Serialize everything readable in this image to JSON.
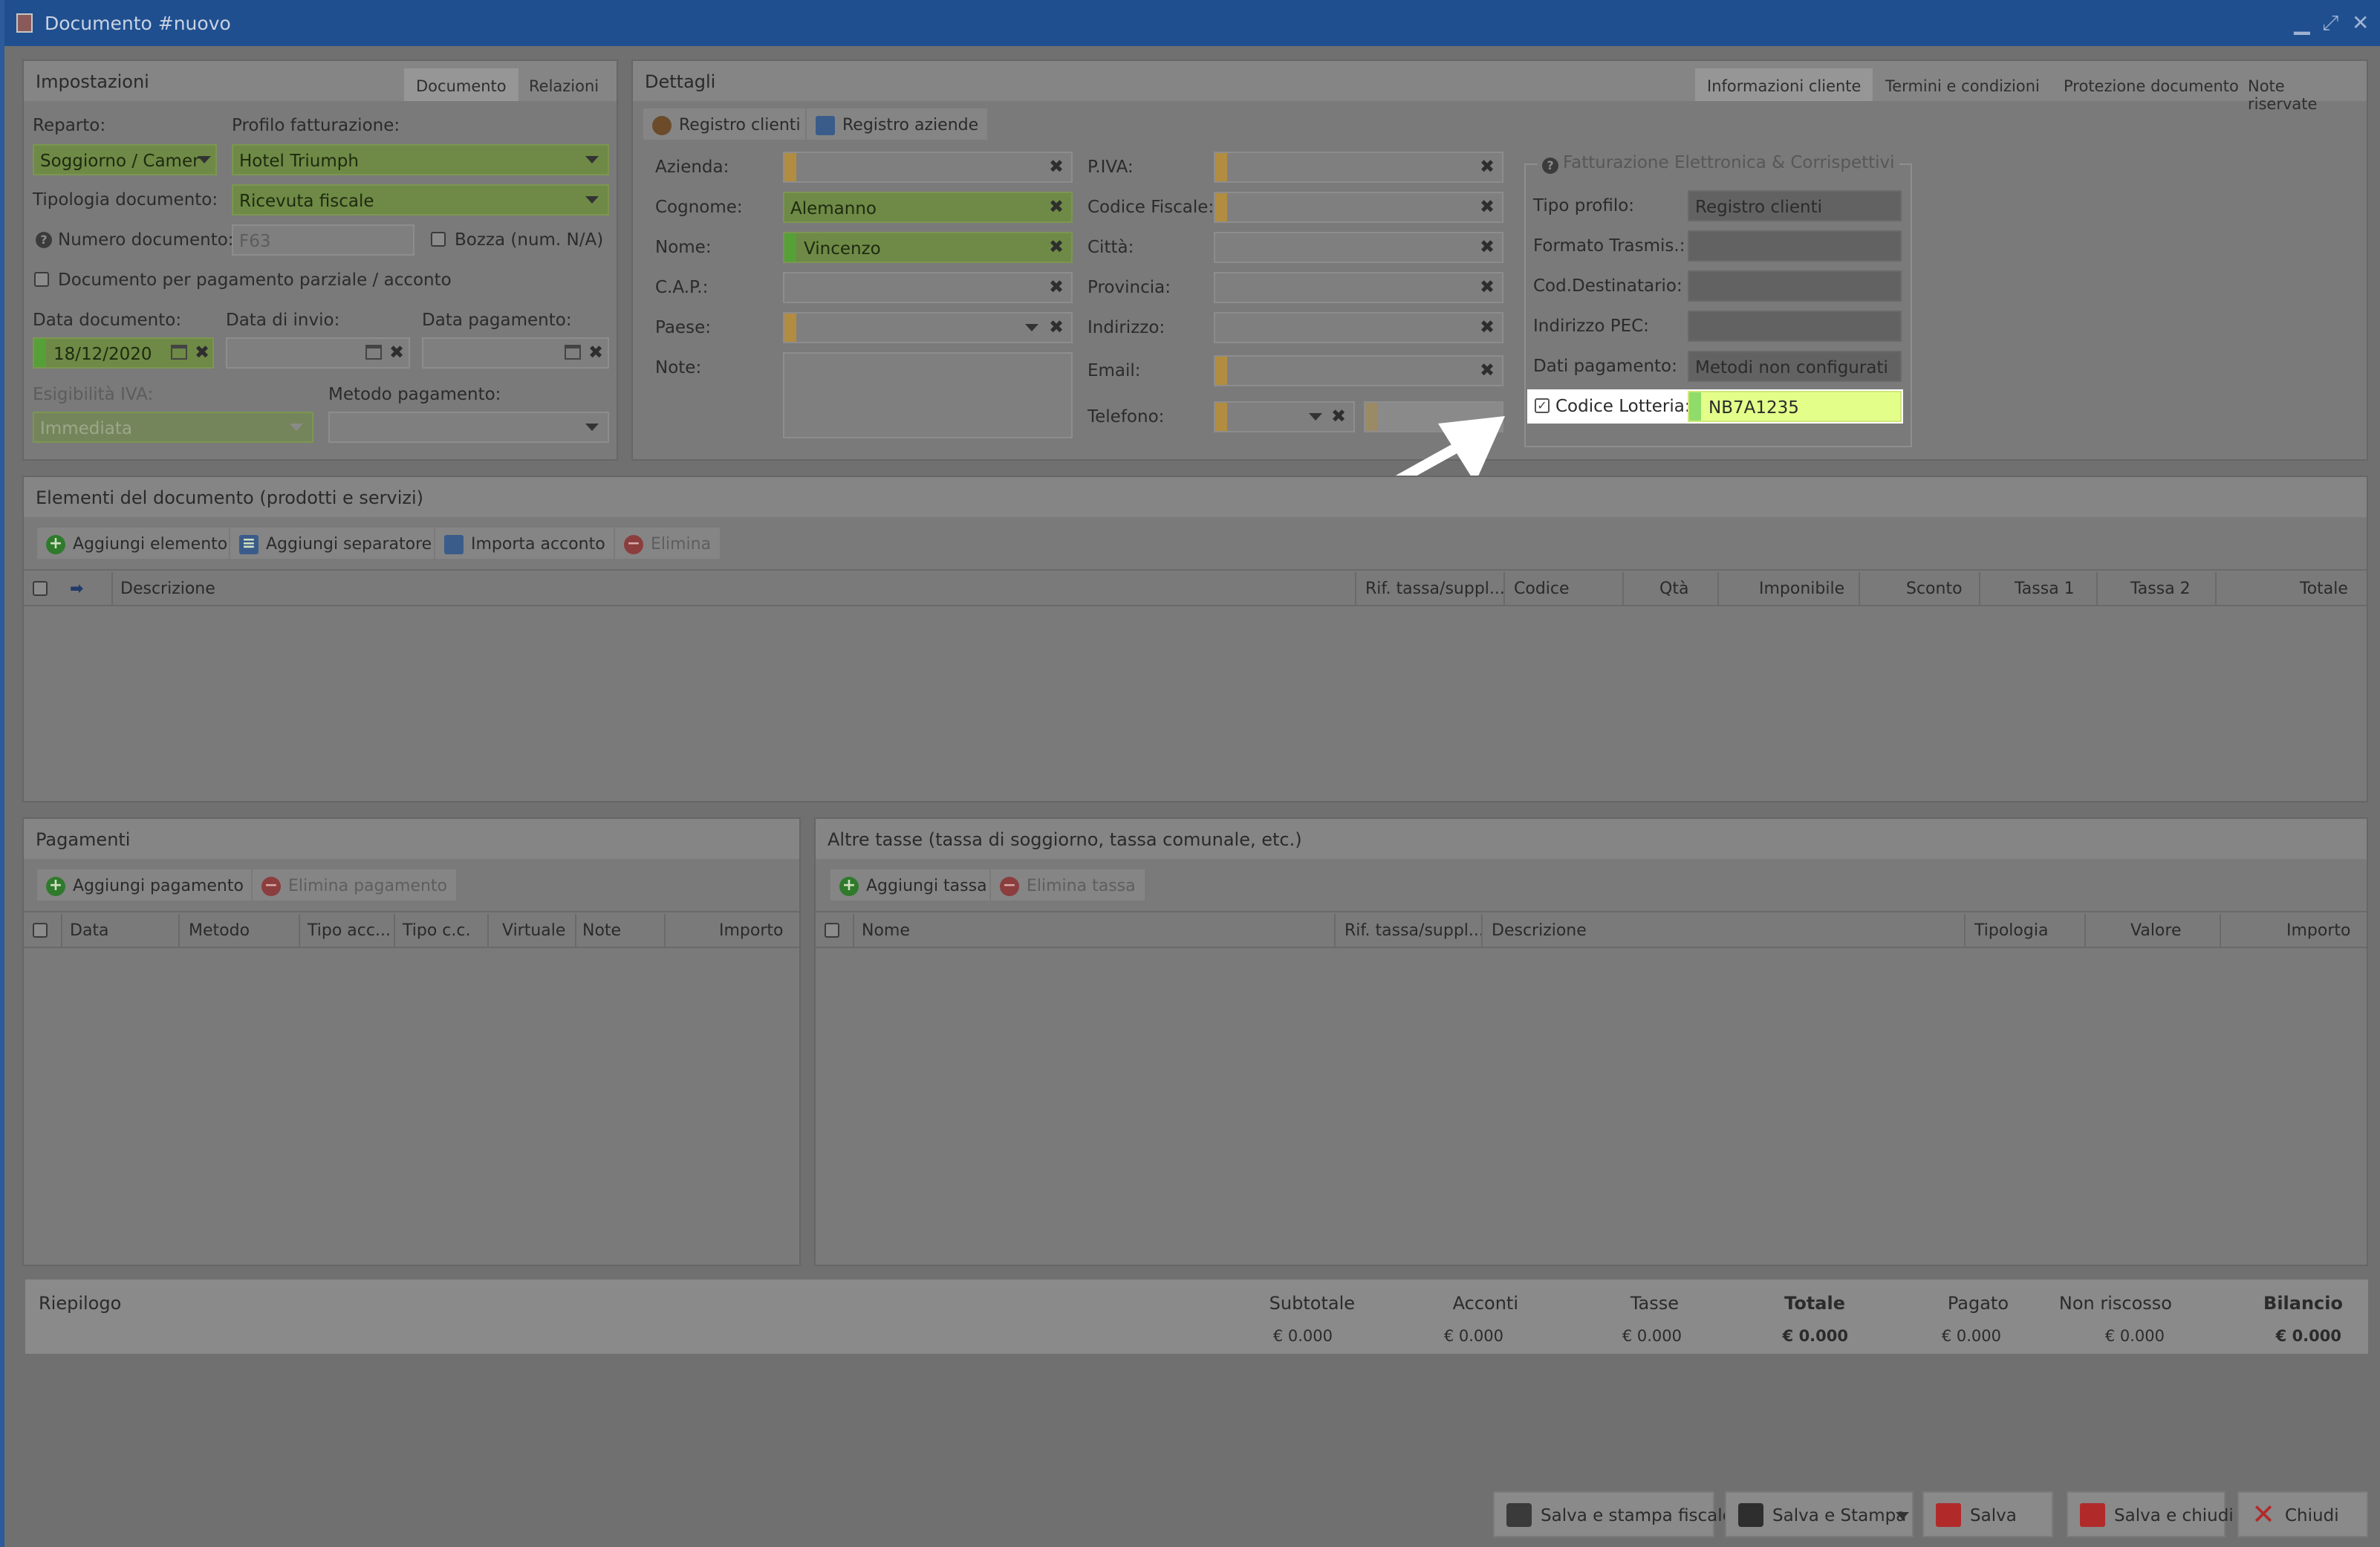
{
  "window": {
    "title": "Documento #nuovo",
    "controls": [
      "▁",
      "⤢",
      "✕"
    ]
  },
  "settings": {
    "title": "Impostazioni",
    "tabs": [
      "Documento",
      "Relazioni"
    ],
    "reparto_label": "Reparto:",
    "reparto_value": "Soggiorno / Camer",
    "profilo_label": "Profilo fatturazione:",
    "profilo_value": "Hotel Triumph",
    "tipologia_label": "Tipologia documento:",
    "tipologia_value": "Ricevuta fiscale",
    "numero_label": "Numero documento:",
    "numero_placeholder": "F63",
    "bozza_label": "Bozza (num. N/A)",
    "parziale_label": "Documento per pagamento parziale / acconto",
    "data_doc_label": "Data documento:",
    "data_doc_value": "18/12/2020",
    "data_invio_label": "Data di invio:",
    "data_pag_label": "Data pagamento:",
    "esigibilita_label": "Esigibilità IVA:",
    "esigibilita_value": "Immediata",
    "metodo_label": "Metodo pagamento:"
  },
  "details": {
    "title": "Dettagli",
    "tabs": [
      "Informazioni cliente",
      "Termini e condizioni",
      "Protezione documento",
      "Note riservate"
    ],
    "registro_clienti": "Registro clienti",
    "registro_aziende": "Registro aziende",
    "azienda_label": "Azienda:",
    "cognome_label": "Cognome:",
    "cognome_value": "Alemanno",
    "nome_label": "Nome:",
    "nome_value": "Vincenzo",
    "cap_label": "C.A.P.:",
    "paese_label": "Paese:",
    "note_label": "Note:",
    "piva_label": "P.IVA:",
    "cf_label": "Codice Fiscale:",
    "citta_label": "Città:",
    "provincia_label": "Provincia:",
    "indirizzo_label": "Indirizzo:",
    "email_label": "Email:",
    "telefono_label": "Telefono:",
    "fe": {
      "legend": "Fatturazione Elettronica & Corrispettivi",
      "tipo_profilo_label": "Tipo profilo:",
      "tipo_profilo_value": "Registro clienti",
      "formato_label": "Formato Trasmis.:",
      "coddest_label": "Cod.Destinatario:",
      "pec_label": "Indirizzo PEC:",
      "dati_pag_label": "Dati pagamento:",
      "dati_pag_value": "Metodi non configurati",
      "lotteria_label": "Codice Lotteria:",
      "lotteria_value": "NB7A1235"
    }
  },
  "elements": {
    "title": "Elementi del documento (prodotti e servizi)",
    "buttons": [
      "Aggiungi elemento",
      "Aggiungi separatore",
      "Importa acconto",
      "Elimina"
    ],
    "columns": [
      "Descrizione",
      "Rif. tassa/suppl...",
      "Codice",
      "Qtà",
      "Imponibile",
      "Sconto",
      "Tassa 1",
      "Tassa 2",
      "Totale"
    ]
  },
  "payments": {
    "title": "Pagamenti",
    "buttons": [
      "Aggiungi pagamento",
      "Elimina pagamento"
    ],
    "columns": [
      "Data",
      "Metodo",
      "Tipo acc...",
      "Tipo c.c.",
      "Virtuale",
      "Note",
      "Importo"
    ]
  },
  "taxes": {
    "title": "Altre tasse (tassa di soggiorno, tassa comunale, etc.)",
    "buttons": [
      "Aggiungi tassa",
      "Elimina tassa"
    ],
    "columns": [
      "Nome",
      "Rif. tassa/suppl...",
      "Descrizione",
      "Tipologia",
      "Valore",
      "Importo"
    ]
  },
  "summary": {
    "title": "Riepilogo",
    "labels": [
      "Subtotale",
      "Acconti",
      "Tasse",
      "Totale",
      "Pagato",
      "Non riscosso",
      "Bilancio"
    ],
    "values": [
      "€ 0.000",
      "€ 0.000",
      "€ 0.000",
      "€ 0.000",
      "€ 0.000",
      "€ 0.000",
      "€ 0.000"
    ]
  },
  "footer": {
    "buttons": [
      "Salva e stampa fiscale",
      "Salva e Stampa",
      "Salva",
      "Salva e chiudi",
      "Chiudi"
    ]
  },
  "colors": {
    "titlebar": "#1f4f8f",
    "required_marker": "#b28c40",
    "filled_field": "#6e8a46",
    "highlight_field": "#e3ff8a"
  }
}
